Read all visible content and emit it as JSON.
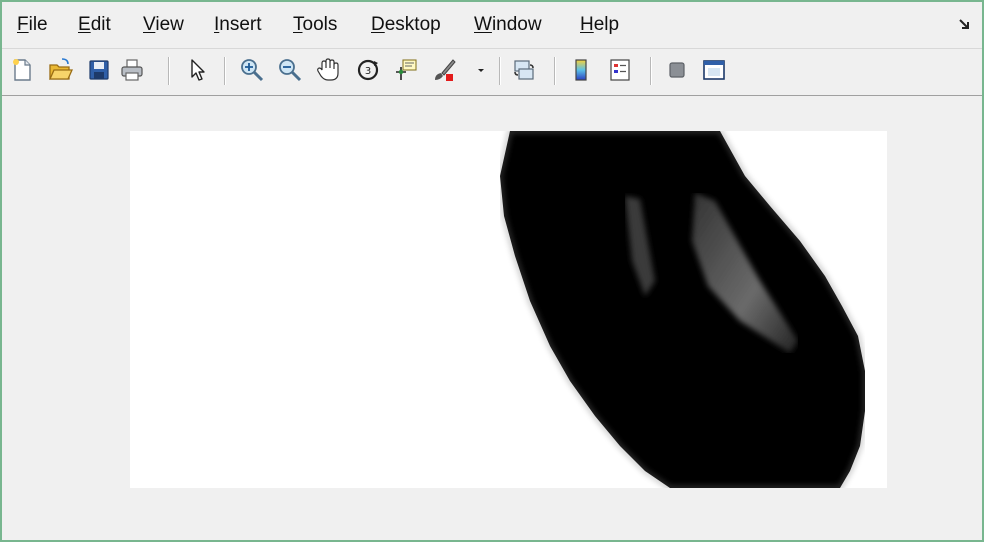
{
  "menu": {
    "file": {
      "acc": "F",
      "rest": "ile"
    },
    "edit": {
      "acc": "E",
      "rest": "dit"
    },
    "view": {
      "acc": "V",
      "rest": "iew"
    },
    "insert": {
      "acc": "I",
      "rest": "nsert"
    },
    "tools": {
      "acc": "T",
      "rest": "ools"
    },
    "desktop": {
      "acc": "D",
      "rest": "esktop"
    },
    "window": {
      "acc": "W",
      "rest": "indow"
    },
    "help": {
      "acc": "H",
      "rest": "elp"
    }
  },
  "toolbar": {
    "icons": [
      "new-figure-icon",
      "open-file-icon",
      "save-icon",
      "print-icon",
      "edit-plot-arrow-icon",
      "zoom-in-icon",
      "zoom-out-icon",
      "pan-hand-icon",
      "rotate-3d-icon",
      "data-cursor-icon",
      "brush-icon",
      "brush-dropdown-icon",
      "link-plot-icon",
      "colorbar-icon",
      "legend-icon",
      "hide-plot-tools-icon",
      "show-plot-tools-icon"
    ]
  },
  "colors": {
    "window_border": "#78b68f",
    "background": "#f0f0f0",
    "image_dark": "#000000",
    "image_light": "#ffffff"
  }
}
